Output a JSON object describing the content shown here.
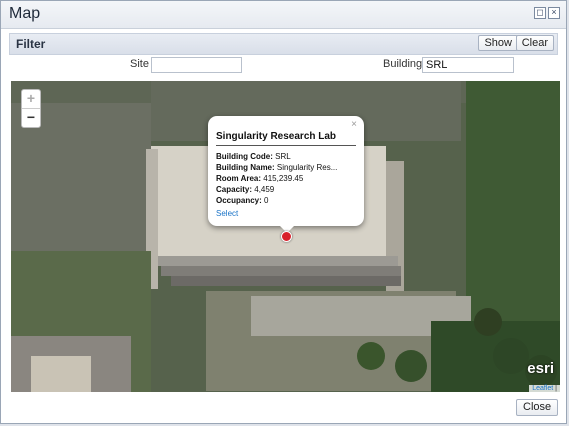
{
  "window": {
    "title": "Map",
    "min_icon": "minimize-icon",
    "close_icon": "close-icon"
  },
  "filter": {
    "label": "Filter",
    "show_label": "Show",
    "clear_label": "Clear",
    "site_label": "Site",
    "site_value": "",
    "building_label": "Building",
    "building_value": "SRL"
  },
  "map": {
    "zoom_in": "+",
    "zoom_out": "−",
    "popup": {
      "close": "×",
      "title": "Singularity Research Lab",
      "rows": [
        {
          "k": "Building Code:",
          "v": " SRL"
        },
        {
          "k": "Building Name:",
          "v": " Singularity Res..."
        },
        {
          "k": "Room Area:",
          "v": " 415,239.45"
        },
        {
          "k": "Capacity:",
          "v": " 4,459"
        },
        {
          "k": "Occupancy:",
          "v": " 0"
        }
      ],
      "select_label": "Select"
    },
    "marker_color": "#d8202a",
    "esri_logo": "esri",
    "attribution_link": "Leaflet",
    "attribution_sep": " |"
  },
  "footer": {
    "close_label": "Close"
  }
}
